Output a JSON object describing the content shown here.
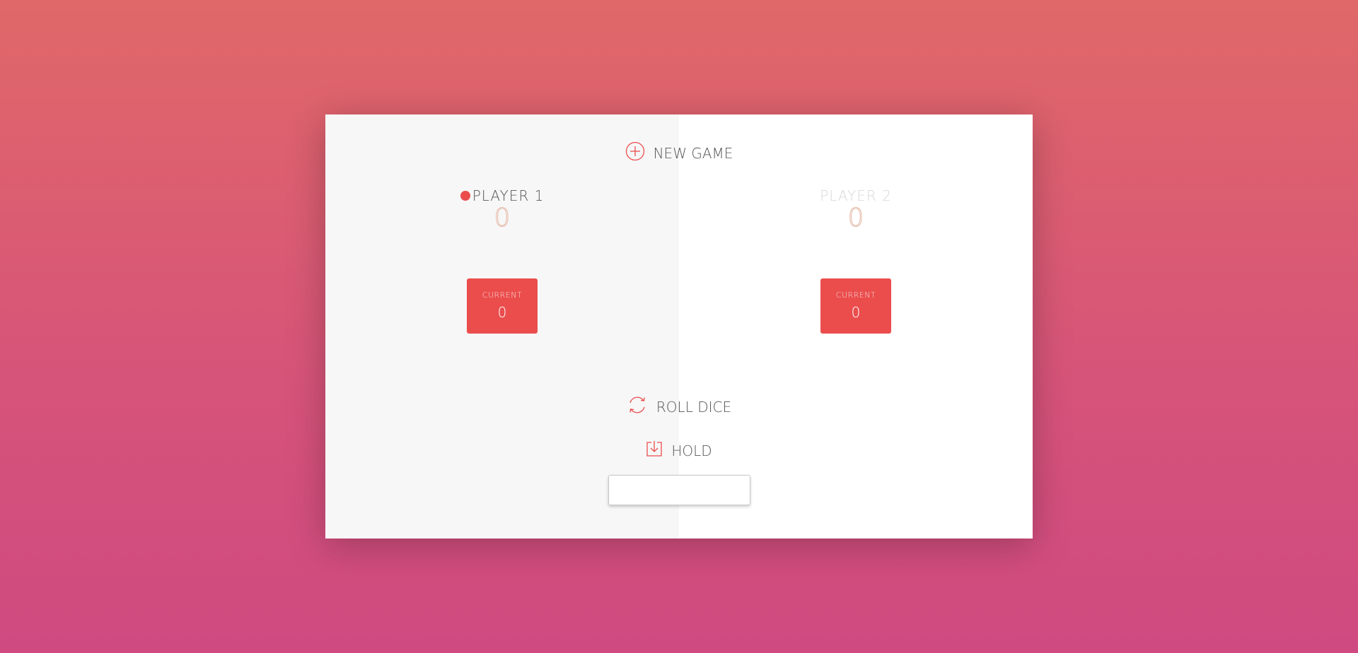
{
  "game": {
    "new_game_label": "NEW GAME",
    "roll_dice_label": "ROLL DICE",
    "hold_label": "HOLD",
    "final_score_value": "",
    "final_score_placeholder": ""
  },
  "players": [
    {
      "name": "PLAYER 1",
      "score": "0",
      "current_label": "CURRENT",
      "current_score": "0",
      "active": true
    },
    {
      "name": "PLAYER 2",
      "score": "0",
      "current_label": "CURRENT",
      "current_score": "0",
      "active": false
    }
  ],
  "icons": {
    "new_game": "plus-circle-icon",
    "roll_dice": "refresh-icon",
    "hold": "download-icon",
    "active": "active-dot"
  },
  "colors": {
    "accent": "#eb4d4d",
    "text": "#555555",
    "inactive_text": "#d8d8d8",
    "panel_active": "#f7f7f7",
    "panel_inactive": "#ffffff"
  }
}
